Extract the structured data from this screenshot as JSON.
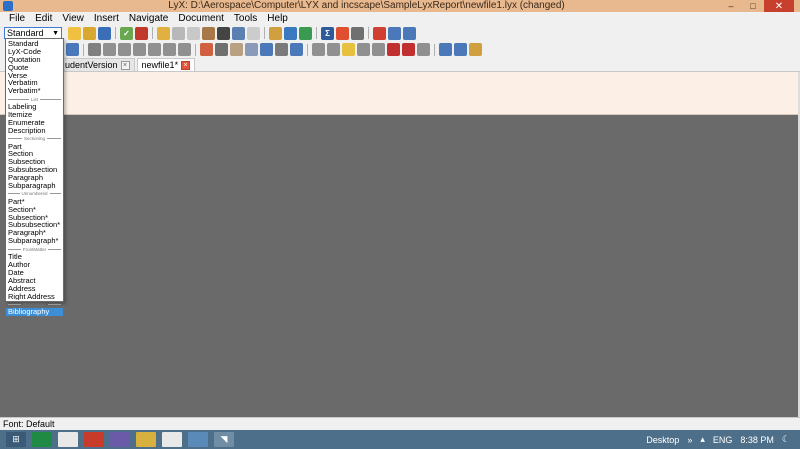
{
  "window": {
    "title": "LyX: D:\\Aerospace\\Computer\\LYX and incscape\\SampleLyxReport\\newfile1.lyx (changed)",
    "minimize": "–",
    "maximize": "□",
    "close": "✕"
  },
  "menu": [
    "File",
    "Edit",
    "View",
    "Insert",
    "Navigate",
    "Document",
    "Tools",
    "Help"
  ],
  "layout_select": {
    "value": "Standard"
  },
  "tabs": [
    {
      "label": "udentVersion"
    },
    {
      "label": "newfile1*"
    }
  ],
  "dropdown": {
    "groups": [
      {
        "header": "",
        "items": [
          "Standard",
          "LyX-Code",
          "Quotation",
          "Quote",
          "Verse",
          "Verbatim",
          "Verbatim*"
        ]
      },
      {
        "header": "List",
        "items": [
          "Labeling",
          "Itemize",
          "Enumerate",
          "Description"
        ]
      },
      {
        "header": "Sectioning",
        "items": [
          "Part",
          "Section",
          "Subsection",
          "Subsubsection",
          "Paragraph",
          "Subparagraph"
        ]
      },
      {
        "header": "Unnumbered",
        "items": [
          "Part*",
          "Section*",
          "Subsection*",
          "Subsubsection*",
          "Paragraph*",
          "Subparagraph*"
        ]
      },
      {
        "header": "FrontMatter",
        "items": [
          "Title",
          "Author",
          "Date",
          "Abstract",
          "Address",
          "Right Address"
        ]
      },
      {
        "header": "BackMatter",
        "items": [
          "Bibliography"
        ]
      }
    ],
    "selected": "Bibliography"
  },
  "statusbar": {
    "text": "Font: Default"
  },
  "taskbar": {
    "tray_desktop": "Desktop",
    "tray_chevron": "»",
    "tray_up": "▴",
    "tray_lang": "ENG",
    "tray_time": "8:38 PM"
  },
  "colors": {
    "titlebar": "#e8b88f",
    "close": "#c7402d",
    "document_top": "#fcf0e6",
    "document_body": "#6a6a6a",
    "selection": "#3c8fd6",
    "taskbar": "#4d6f8a"
  }
}
